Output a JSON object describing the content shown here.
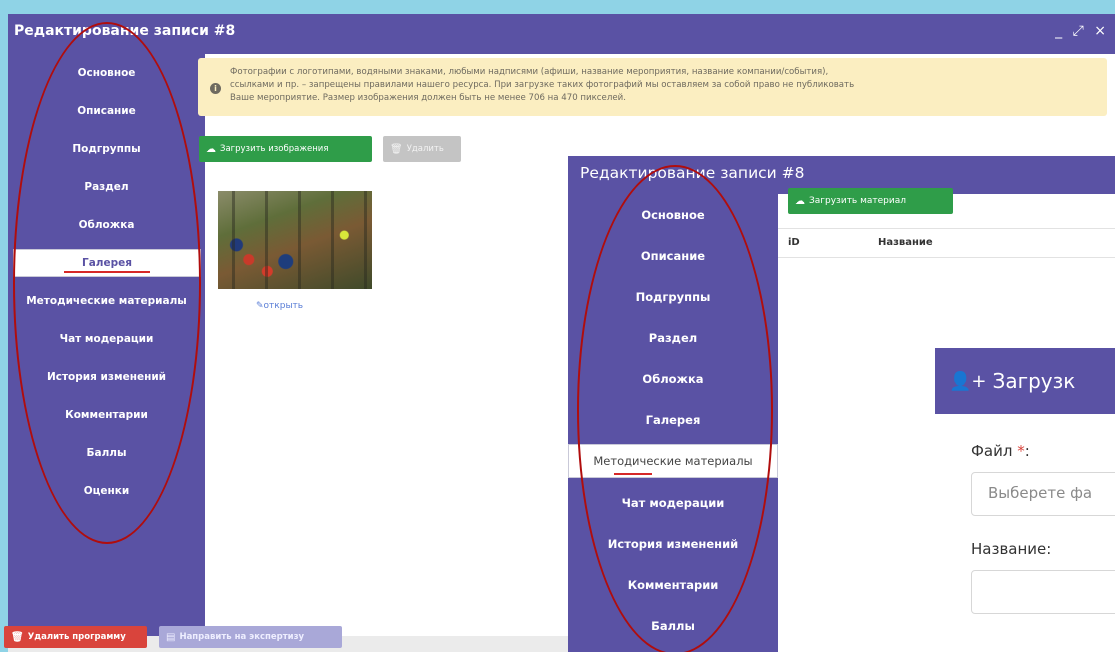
{
  "back_window": {
    "title": "Редактирование записи #8",
    "window_controls": "_ ⤢ ×",
    "sidebar": {
      "items": [
        {
          "label": "Основное"
        },
        {
          "label": "Описание"
        },
        {
          "label": "Подгруппы"
        },
        {
          "label": "Раздел"
        },
        {
          "label": "Обложка"
        },
        {
          "label": "Галерея",
          "active": true
        },
        {
          "label": "Методические материалы"
        },
        {
          "label": "Чат модерации"
        },
        {
          "label": "История изменений"
        },
        {
          "label": "Комментарии"
        },
        {
          "label": "Баллы"
        },
        {
          "label": "Оценки"
        }
      ]
    },
    "notice": {
      "line1": "Фотографии с логотипами, водяными знаками, любыми надписями (афиши, название мероприятия, название компании/события),",
      "line2": "ссылками и пр. – запрещены правилами нашего ресурса. При загрузке таких фотографий мы оставляем за собой право не публиковать",
      "line3": "Ваше мероприятие. Размер изображения должен быть не менее 706 на 470 пикселей."
    },
    "toolbar": {
      "upload_label": "Загрузить изображения",
      "delete_label": "Удалить"
    },
    "gallery": {
      "open_label": "открыть"
    },
    "footer": {
      "delete_program_label": "Удалить программу",
      "send_expertise_label": "Направить на экспертизу"
    }
  },
  "front_window": {
    "title": "Редактирование записи #8",
    "sidebar": {
      "items": [
        {
          "label": "Основное"
        },
        {
          "label": "Описание"
        },
        {
          "label": "Подгруппы"
        },
        {
          "label": "Раздел"
        },
        {
          "label": "Обложка"
        },
        {
          "label": "Галерея"
        },
        {
          "label": "Методические материалы",
          "active": true
        },
        {
          "label": "Чат модерации"
        },
        {
          "label": "История изменений"
        },
        {
          "label": "Комментарии"
        },
        {
          "label": "Баллы"
        }
      ]
    },
    "toolbar": {
      "upload_label": "Загрузить материал"
    },
    "table": {
      "columns": [
        "iD",
        "Название"
      ]
    }
  },
  "modal": {
    "title": "Загрузк",
    "file_label": "Файл",
    "required_mark": "*",
    "colon": ":",
    "file_placeholder": "Выберете фа",
    "name_label": "Название:"
  },
  "colors": {
    "sidebar": "#5a52a4",
    "success": "#2f9d49",
    "danger": "#d9443c",
    "notice_bg": "#fbeec1",
    "annotation": "#b00d0d",
    "background": "#8fd3e6"
  }
}
